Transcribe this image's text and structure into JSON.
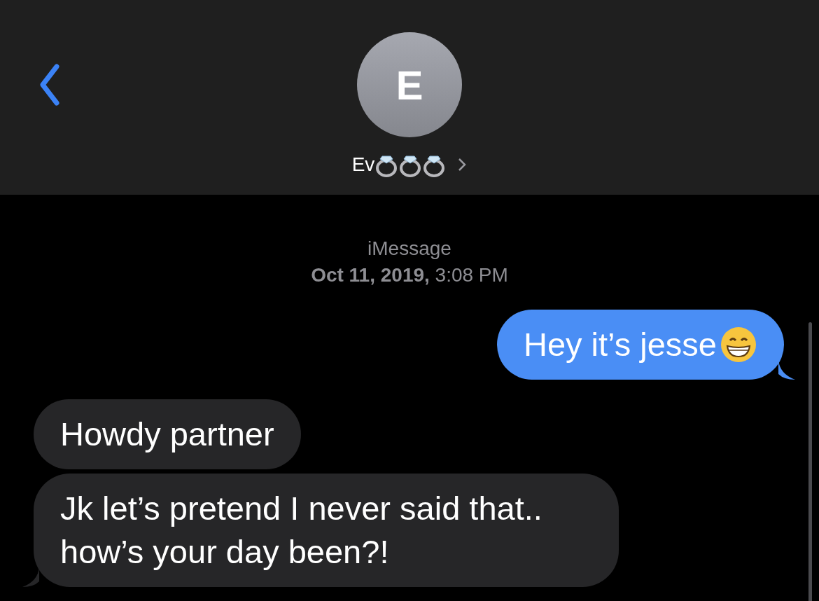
{
  "header": {
    "avatar_initial": "E",
    "contact_name": "Ev",
    "name_rings": true
  },
  "service": "iMessage",
  "timestamp": "**Oct 11, 2019,** 3:08 PM",
  "messages": [
    {
      "kind": "sent",
      "text": "Hey it’s jesse",
      "emoji": true,
      "tail": true
    },
    {
      "kind": "received",
      "text": "Howdy partner",
      "emoji": false,
      "tail": false
    },
    {
      "kind": "received",
      "text": "Jk let’s pretend I never said that.. how’s your day been?!",
      "emoji": false,
      "tail": true
    }
  ]
}
